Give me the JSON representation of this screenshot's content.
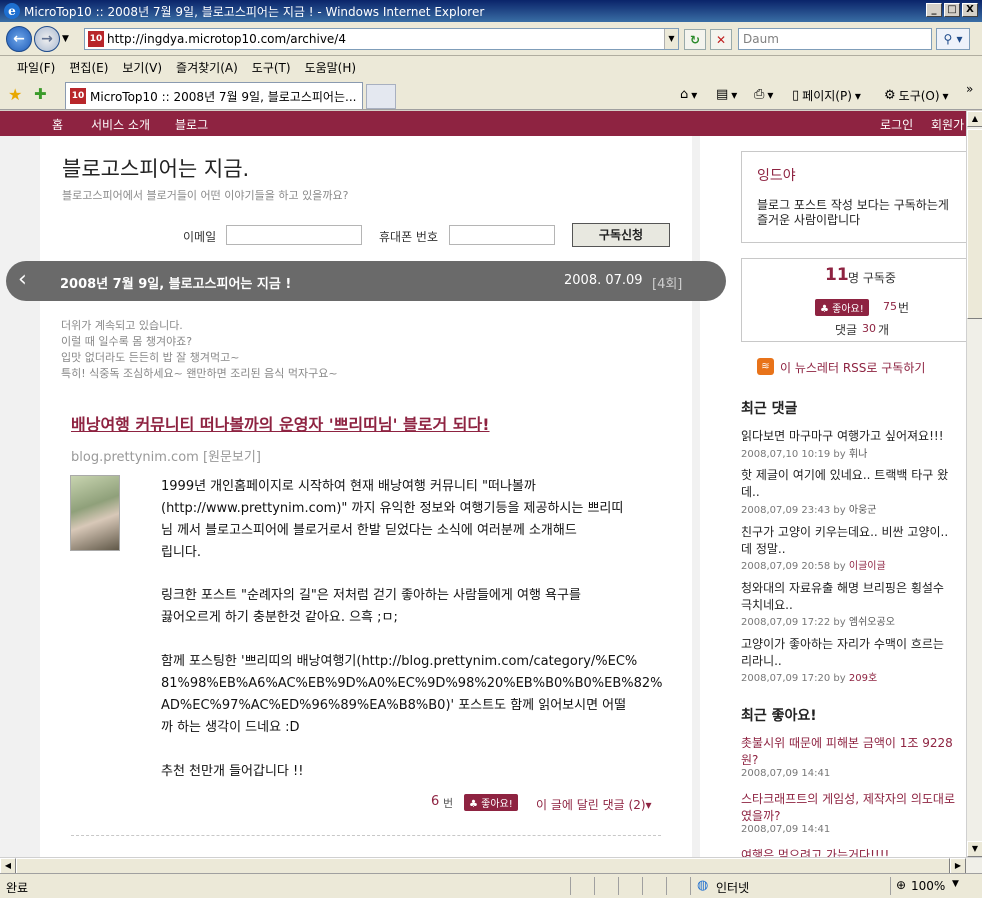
{
  "window": {
    "title": "MicroTop10 :: 2008년 7월 9일, 블로고스피어는 지금 ! - Windows Internet Explorer",
    "minimize": "_",
    "maximize": "□",
    "close": "X"
  },
  "address": {
    "url": "http://ingdya.microtop10.com/archive/4",
    "search_placeholder": "Daum"
  },
  "menu": [
    "파일(F)",
    "편집(E)",
    "보기(V)",
    "즐겨찾기(A)",
    "도구(T)",
    "도움말(H)"
  ],
  "tab": {
    "label": "MicroTop10 :: 2008년 7월 9일, 블로고스피어는...",
    "page_menu": "페이지(P)",
    "tools_menu": "도구(O)"
  },
  "site_nav": {
    "home": "홈",
    "service": "서비스 소개",
    "blog": "블로그",
    "login": "로그인",
    "join": "회원가"
  },
  "header": {
    "title": "블로고스피어는 지금.",
    "subtitle": "블로고스피어에서 블로거들이 어떤 이야기들을 하고 있을까요?",
    "email_label": "이메일",
    "phone_label": "휴대폰 번호",
    "subscribe_button": "구독신청"
  },
  "issue_bar": {
    "title": "2008년 7월 9일, 블로고스피어는 지금 !",
    "date": "2008. 07.09",
    "issue": "[4회]"
  },
  "intro": [
    "더위가 계속되고 있습니다.",
    "이럴 때 일수록 몸 챙겨야죠?",
    "입맛 없더라도 든든히 밥 잘 챙겨먹고~",
    "특히! 식중독 조심하세요~ 왠만하면 조리된 음식 먹자구요~"
  ],
  "post": {
    "title": "배낭여행 커뮤니티 떠나볼까의 운영자 '쁘리띠님' 블로거 되다!",
    "source": "blog.prettynim.com [원문보기]",
    "paragraphs": [
      [
        "1999년 개인홈페이지로 시작하여 현재 배낭여행 커뮤니티 \"떠나볼까",
        "(http://www.prettynim.com)\" 까지 유익한 정보와 여행기등을 제공하시는 쁘리띠",
        "님 께서 블로고스피어에 블로거로서 한발 딛었다는 소식에 여러분께 소개해드",
        "립니다."
      ],
      [
        "링크한 포스트 \"순례자의 길\"은 저처럼 걷기 좋아하는 사람들에게 여행 욕구를",
        "끓어오르게 하기 충분한것 같아요. 으흑 ;ㅁ;"
      ],
      [
        "함께 포스팅한 '쁘리띠의 배낭여행기(http://blog.prettynim.com/category/%EC%",
        "81%98%EB%A6%AC%EB%9D%A0%EC%9D%98%20%EB%B0%B0%EB%82%",
        "AD%EC%97%AC%ED%96%89%EA%B8%B0)' 포스트도 함께 읽어보시면 어떨",
        "까 하는 생각이 드네요 :D"
      ],
      [
        "추천 천만개 들어갑니다 !!"
      ]
    ],
    "like_count": "6",
    "like_unit": "번",
    "like_button": "좋아요!",
    "comments_link": "이 글에 달린 댓글 (2)▾"
  },
  "sidebar": {
    "profile_name": "잉드야",
    "profile_desc_1": "블로그 포스트 작성 보다는 구독하는게",
    "profile_desc_2": "즐거운 사람이랍니다",
    "subscribers_count": "11",
    "subscribers_label": "명 구독중",
    "like_button": "좋아요!",
    "like_count": "75",
    "like_unit": "번",
    "comment_label": "댓글",
    "comment_count": "30",
    "comment_unit": "개",
    "rss_text": "이 뉴스레터 RSS로 구독하기",
    "recent_comments_title": "최근 댓글",
    "recent_comments": [
      {
        "lines": [
          "읽다보면 마구마구 여행가고 싶어져요!!!"
        ],
        "meta": "2008,07,10 10:19 by ",
        "by": "휘나"
      },
      {
        "lines": [
          "핫 제글이 여기에 있네요.. 트랙백 타구 왔",
          "데.."
        ],
        "meta": "2008,07,09 23:43 by ",
        "by": "아웅군"
      },
      {
        "lines": [
          "친구가 고양이 키우는데요.. 비싼 고양이..",
          "데 정말.."
        ],
        "meta": "2008,07,09 20:58 by ",
        "by": "이글이글"
      },
      {
        "lines": [
          "청와대의 자료유출 해명 브리핑은 횡설수",
          "극치네요.."
        ],
        "meta": "2008,07,09 17:22 by ",
        "by": "엠쉬오공오"
      },
      {
        "lines": [
          "고양이가 좋아하는 자리가 수맥이 흐르는",
          "리라니.."
        ],
        "meta": "2008,07,09 17:20 by ",
        "by": "209호"
      }
    ],
    "recent_likes_title": "최근 좋아요!",
    "recent_likes": [
      {
        "lines": [
          "촛불시위 때문에 피해본 금액이 1조 9228",
          "원?"
        ],
        "meta": "2008,07,09 14:41"
      },
      {
        "lines": [
          "스타크래프트의 게임성, 제작자의 의도대로",
          "였을까?"
        ],
        "meta": "2008,07,09 14:41"
      },
      {
        "lines": [
          "여행은 먹으려고 가는거다!!!!"
        ],
        "meta": ""
      }
    ]
  },
  "status": {
    "left": "완료",
    "zone": "인터넷",
    "zoom": "100%"
  }
}
